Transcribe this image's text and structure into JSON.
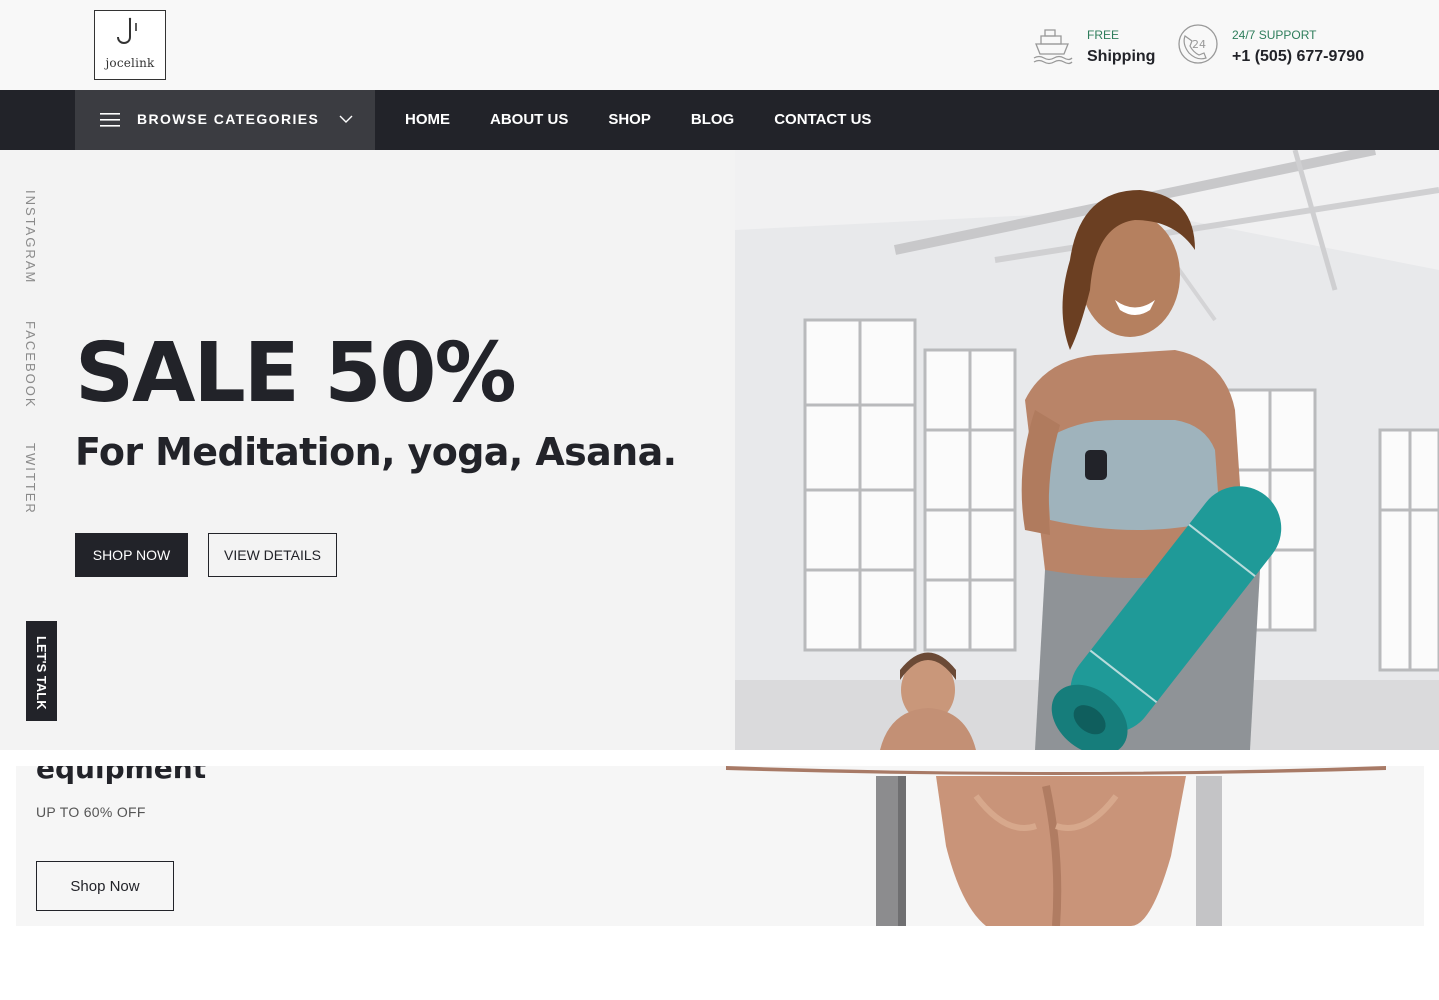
{
  "brand": {
    "logo_text": "jocelink"
  },
  "header": {
    "shipping": {
      "small": "FREE",
      "big": "Shipping",
      "icon": "ship-icon"
    },
    "support": {
      "small": "24/7 SUPPORT",
      "big": "+1 (505) 677-9790",
      "icon": "support-24-icon"
    }
  },
  "nav": {
    "browse_label": "BROWSE CATEGORIES",
    "items": [
      {
        "label": "HOME"
      },
      {
        "label": "ABOUT US"
      },
      {
        "label": "SHOP"
      },
      {
        "label": "BLOG"
      },
      {
        "label": "CONTACT US"
      }
    ]
  },
  "social": [
    {
      "label": "INSTAGRAM"
    },
    {
      "label": "FACEBOOK"
    },
    {
      "label": "TWITTER"
    }
  ],
  "hero": {
    "title": "SALE 50%",
    "subtitle": "For Meditation, yoga, Asana.",
    "primary_button": "SHOP NOW",
    "secondary_button": "VIEW DETAILS",
    "image": "woman-with-yoga-mat-photo"
  },
  "lets_talk": "LET'S TALK",
  "promo": {
    "title": "equipment",
    "discount": "UP TO 60% OFF",
    "button": "Shop Now",
    "image": "athlete-back-photo"
  },
  "colors": {
    "dark": "#222329",
    "browse_bg": "#3b3c41",
    "accent_green": "#2e7d5b",
    "hero_bg": "#f3f3f3",
    "mat_teal": "#1f9a98"
  }
}
